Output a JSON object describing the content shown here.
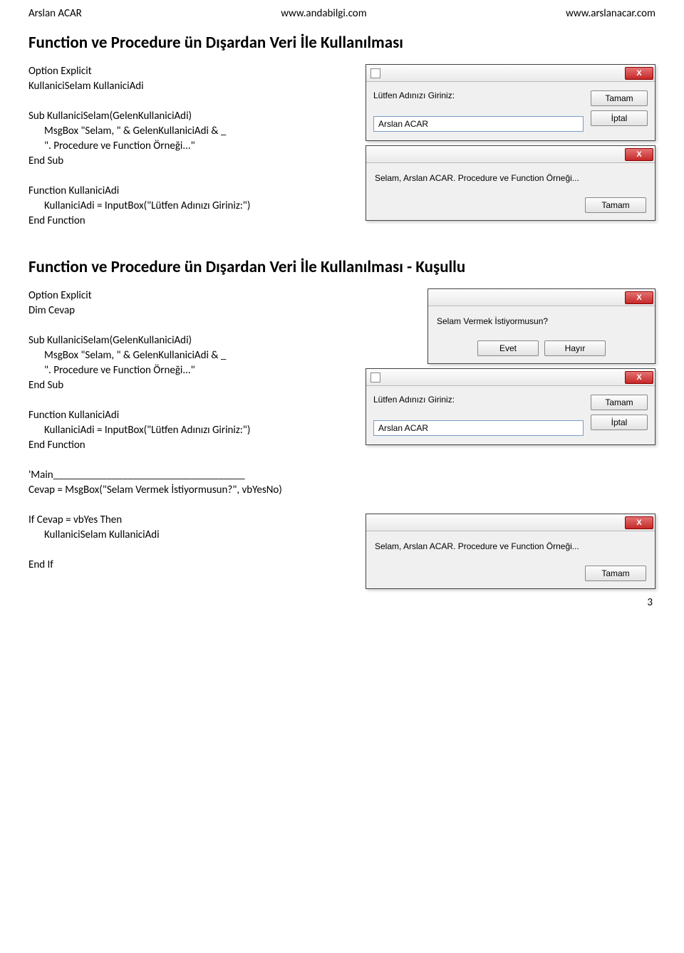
{
  "header": {
    "author": "Arslan ACAR",
    "site1": "www.andabilgi.com",
    "site2": "www.arslanacar.com"
  },
  "section1": {
    "title": "Function ve Procedure ün Dışardan Veri İle Kullanılması",
    "code": {
      "l1": "Option Explicit",
      "l2": "KullaniciSelam KullaniciAdi",
      "l3": "Sub KullaniciSelam(GelenKullaniciAdi)",
      "l4": "MsgBox \"Selam, \" & GelenKullaniciAdi & _",
      "l5": "\". Procedure ve Function Örneği...\"",
      "l6": "End Sub",
      "l7": "Function KullaniciAdi",
      "l8": "KullaniciAdi = InputBox(\"Lütfen Adınızı Giriniz:\")",
      "l9": "End Function"
    },
    "dialog1": {
      "prompt": "Lütfen Adınızı Giriniz:",
      "value": "Arslan ACAR",
      "ok": "Tamam",
      "cancel": "İptal"
    },
    "dialog2": {
      "message": "Selam, Arslan ACAR. Procedure ve Function Örneği...",
      "ok": "Tamam"
    }
  },
  "section2": {
    "title": "Function ve Procedure ün Dışardan Veri İle Kullanılması - Kuşullu",
    "code": {
      "l1": "Option Explicit",
      "l2": "Dim Cevap",
      "l3": "Sub KullaniciSelam(GelenKullaniciAdi)",
      "l4": "MsgBox \"Selam, \" & GelenKullaniciAdi & _",
      "l5": "\". Procedure ve Function Örneği...\"",
      "l6": "End Sub",
      "l7": "Function KullaniciAdi",
      "l8": "KullaniciAdi = InputBox(\"Lütfen Adınızı Giriniz:\")",
      "l9": "End Function",
      "l10": "'Main____________________________________",
      "l11": "Cevap = MsgBox(\"Selam Vermek İstiyormusun?\", vbYesNo)",
      "l12": "If Cevap = vbYes Then",
      "l13": "KullaniciSelam KullaniciAdi",
      "l14": "End If"
    },
    "dialogYN": {
      "message": "Selam Vermek İstiyormusun?",
      "yes": "Evet",
      "no": "Hayır"
    },
    "dialogInput": {
      "prompt": "Lütfen Adınızı Giriniz:",
      "value": "Arslan ACAR",
      "ok": "Tamam",
      "cancel": "İptal"
    },
    "dialogMsg": {
      "message": "Selam, Arslan ACAR. Procedure ve Function Örneği...",
      "ok": "Tamam"
    }
  },
  "close_x": "X",
  "page_num": "3"
}
